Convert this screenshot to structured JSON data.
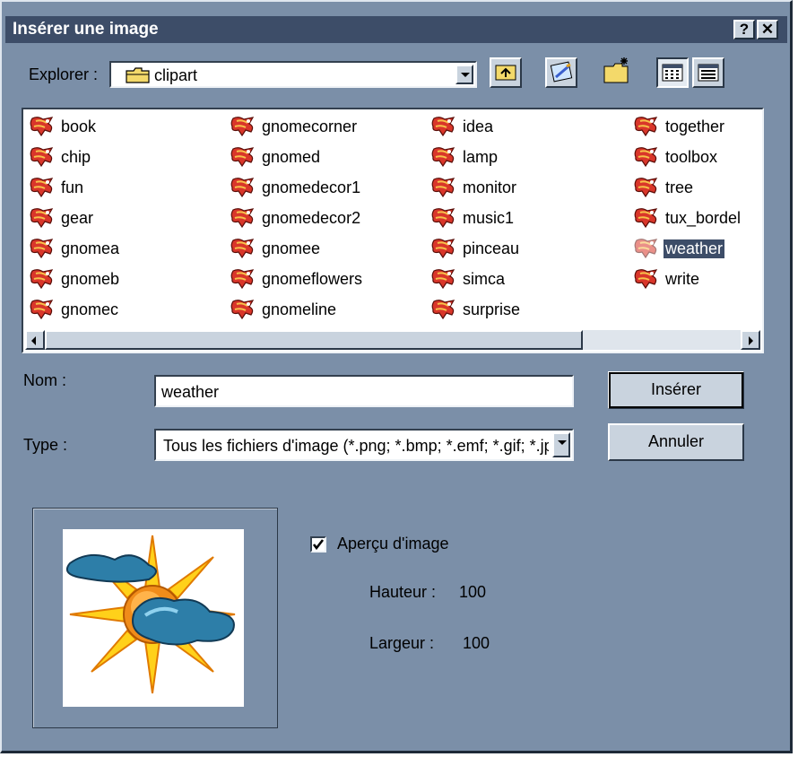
{
  "window": {
    "title": "Insérer une image",
    "help_label": "?",
    "close_label": "✕"
  },
  "explorer": {
    "label": "Explorer :",
    "current_folder": "clipart"
  },
  "toolbar": {
    "icons": [
      "up-folder-icon",
      "desktop-icon",
      "new-folder-icon",
      "list-view-icon",
      "details-view-icon"
    ]
  },
  "files": [
    [
      "book",
      "chip",
      "fun",
      "gear",
      "gnomea",
      "gnomeb",
      "gnomec"
    ],
    [
      "gnomecorner",
      "gnomed",
      "gnomedecor1",
      "gnomedecor2",
      "gnomee",
      "gnomeflowers",
      "gnomeline"
    ],
    [
      "idea",
      "lamp",
      "monitor",
      "music1",
      "pinceau",
      "simca",
      "surprise"
    ],
    [
      "together",
      "toolbox",
      "tree",
      "tux_bordel",
      "weather",
      "write"
    ]
  ],
  "selected_file": "weather",
  "name_field": {
    "label": "Nom :",
    "value": "weather"
  },
  "type_field": {
    "label": "Type :",
    "value": "Tous les fichiers d'image (*.png; *.bmp; *.emf; *.gif; *.jpg)"
  },
  "buttons": {
    "insert": "Insérer",
    "cancel": "Annuler"
  },
  "preview": {
    "checkbox_label": "Aperçu d'image",
    "checked": true,
    "height_label": "Hauteur :",
    "height_value": "100",
    "width_label": "Largeur :",
    "width_value": "100"
  },
  "colors": {
    "dialog_bg": "#7b8fa8",
    "titlebar_bg": "#3d4d68",
    "button_face": "#c9d3de",
    "selection": "#3d4d68"
  }
}
